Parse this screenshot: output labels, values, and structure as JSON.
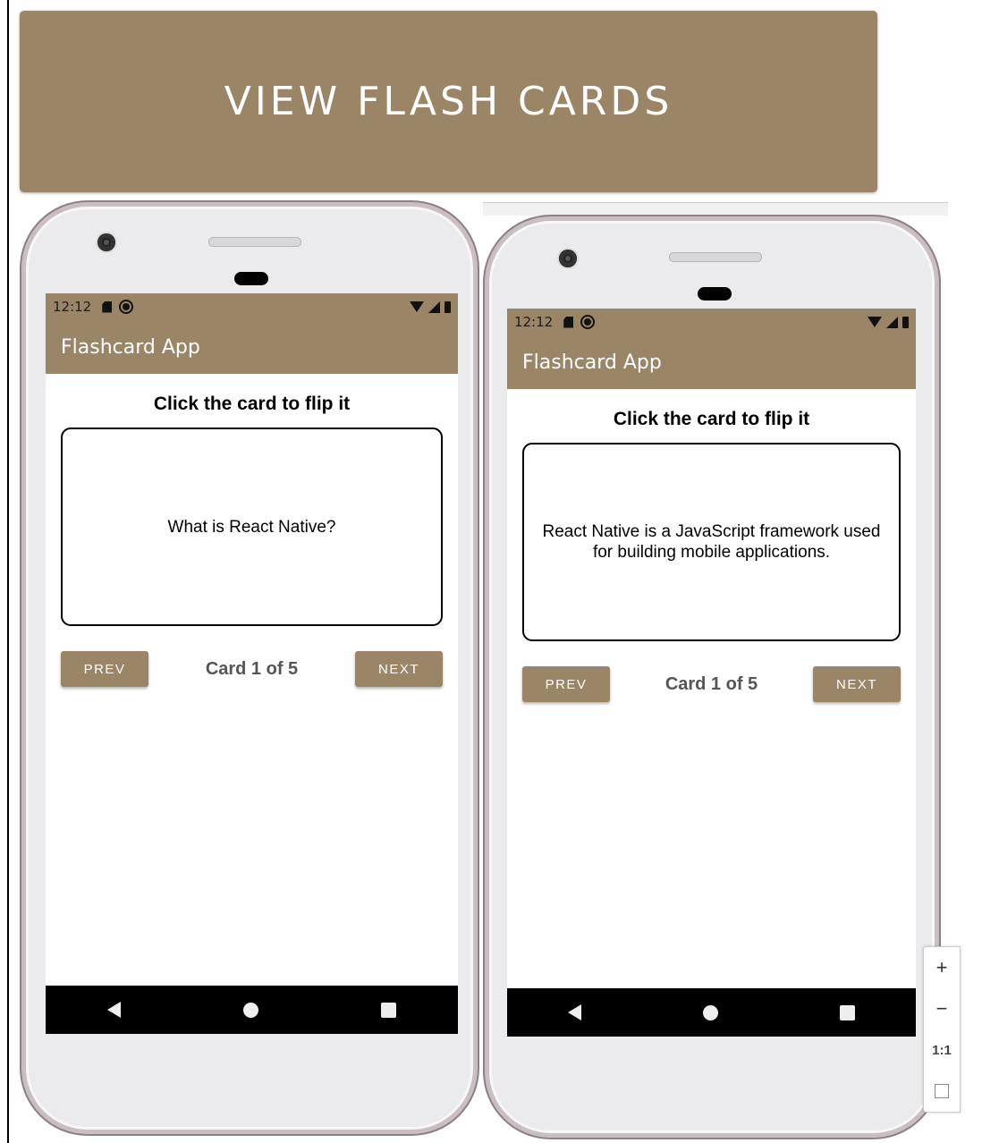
{
  "banner": {
    "title": "VIEW FLASH CARDS"
  },
  "colors": {
    "brand": "#9A8566",
    "navbar": "#000000",
    "screen_bg": "#ffffff"
  },
  "phones": [
    {
      "status": {
        "time": "12:12"
      },
      "appbar": {
        "title": "Flashcard App"
      },
      "instruction": "Click the card to flip it",
      "card_text": "What is React Native?",
      "prev_label": "PREV",
      "next_label": "NEXT",
      "counter": "Card 1 of 5"
    },
    {
      "status": {
        "time": "12:12"
      },
      "appbar": {
        "title": "Flashcard App"
      },
      "instruction": "Click the card to flip it",
      "card_text": "React Native is a JavaScript framework used for building mobile applications.",
      "prev_label": "PREV",
      "next_label": "NEXT",
      "counter": "Card 1 of 5"
    }
  ],
  "zoom_controls": {
    "zoom_in": "+",
    "zoom_out": "−",
    "ratio": "1:1"
  }
}
